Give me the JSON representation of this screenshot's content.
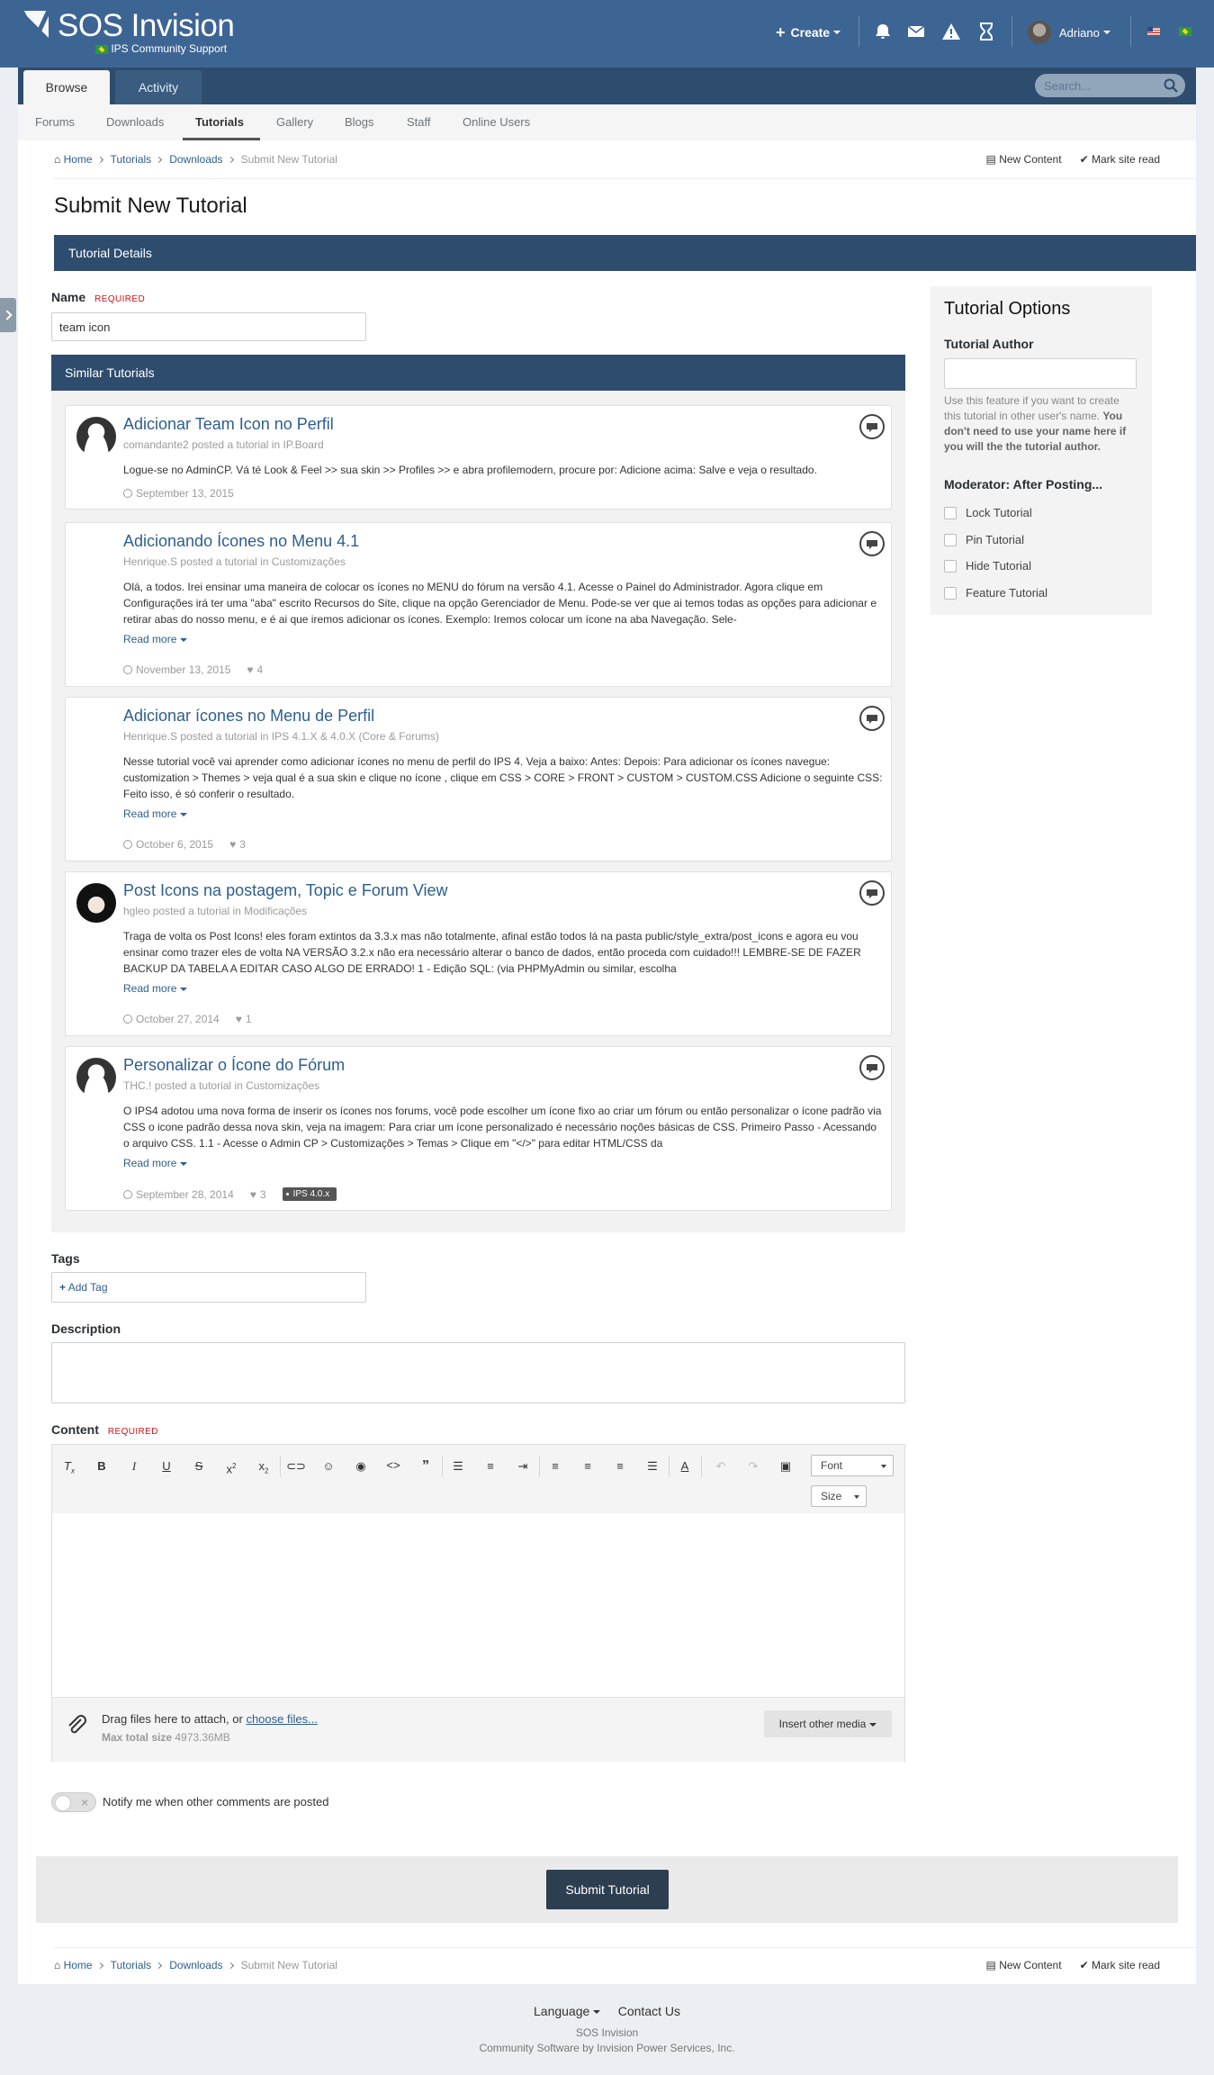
{
  "header": {
    "site_title": "SOS Invision",
    "site_subtitle": "IPS Community Support",
    "create_label": "Create",
    "username": "Adriano",
    "icons": [
      "bell-icon",
      "envelope-icon",
      "warning-icon",
      "hourglass-icon"
    ]
  },
  "nav": {
    "tabs": [
      {
        "label": "Browse",
        "active": true
      },
      {
        "label": "Activity",
        "active": false
      }
    ],
    "search_placeholder": "Search...",
    "sub_items": [
      {
        "label": "Forums"
      },
      {
        "label": "Downloads"
      },
      {
        "label": "Tutorials",
        "active": true
      },
      {
        "label": "Gallery"
      },
      {
        "label": "Blogs"
      },
      {
        "label": "Staff"
      },
      {
        "label": "Online Users"
      }
    ]
  },
  "breadcrumb": {
    "items": [
      "Home",
      "Tutorials",
      "Downloads"
    ],
    "current": "Submit New Tutorial",
    "new_content": "New Content",
    "mark_read": "Mark site read"
  },
  "page_title": "Submit New Tutorial",
  "section_header": "Tutorial Details",
  "form": {
    "name_label": "Name",
    "required_label": "REQUIRED",
    "name_value": "team icon",
    "similar_header": "Similar Tutorials",
    "tags_label": "Tags",
    "add_tag": "Add Tag",
    "description_label": "Description",
    "content_label": "Content",
    "font_label": "Font",
    "size_label": "Size",
    "drop_text": "Drag files here to attach, or",
    "choose_files": "choose files...",
    "max_size_label": "Max total size",
    "max_size_value": "4973.36MB",
    "insert_media": "Insert other media",
    "notify_label": "Notify me when other comments are posted",
    "submit_label": "Submit Tutorial"
  },
  "similar": [
    {
      "title": "Adicionar Team Icon no Perfil",
      "author": "comandante2",
      "posted": "posted a tutorial in",
      "category": "IP.Board",
      "snippet": "Logue-se no AdminCP. Vá té Look & Feel >> sua skin >> Profiles >> e abra profilemodern, procure por: Adicione acima: Salve e veja o resultado.",
      "date": "September 13, 2015",
      "likes": "",
      "read_more": "",
      "tag": "",
      "avatar": "default"
    },
    {
      "title": "Adicionando Ícones no Menu 4.1",
      "author": "Henrique.S",
      "posted": "posted a tutorial in",
      "category": "Customizações",
      "snippet": "Olá, a todos. Irei ensinar uma maneira de colocar os ícones no MENU do fórum na versão 4.1. Acesse o Painel do Administrador. Agora clique em Configurações irá ter uma \"aba\" escrito Recursos do Site, clique na opção Gerenciador de Menu. Pode-se ver que ai temos todas as opções para adicionar e retirar abas do nosso menu, e é ai que iremos adicionar os ícones. Exemplo: Iremos colocar um ícone na aba Navegação. Sele-",
      "date": "November 13, 2015",
      "likes": "4",
      "read_more": "Read more",
      "tag": "",
      "avatar": "none"
    },
    {
      "title": "Adicionar ícones no Menu de Perfil",
      "author": "Henrique.S",
      "posted": "posted a tutorial in",
      "category": "IPS 4.1.X & 4.0.X (Core & Forums)",
      "snippet": "Nesse tutorial você vai aprender como adicionar ícones no menu de perfil do IPS 4. Veja a baixo: Antes: Depois: Para adicionar os ícones navegue: customization > Themes > veja qual é a sua skin e clique no ícone , clique em CSS > CORE > FRONT > CUSTOM > CUSTOM.CSS Adicione o seguinte CSS: Feito isso, é só conferir o resultado.",
      "date": "October 6, 2015",
      "likes": "3",
      "read_more": "Read more",
      "tag": "",
      "avatar": "none"
    },
    {
      "title": "Post Icons na postagem, Topic e Forum View",
      "author": "hgleo",
      "posted": "posted a tutorial in",
      "category": "Modificações",
      "snippet": "Traga de volta os Post Icons! eles foram extintos da 3.3.x mas não totalmente, afinal estão todos lá na pasta public/style_extra/post_icons e agora eu vou ensinar como trazer eles de volta NA VERSÃO 3.2.x não era necessário alterar o banco de dados, então proceda com cuidado!!! LEMBRE-SE DE FAZER BACKUP DA TABELA A EDITAR CASO ALGO DE ERRADO! 1 - Edição SQL: (via PHPMyAdmin ou similar, escolha",
      "date": "October 27, 2014",
      "likes": "1",
      "read_more": "Read more",
      "tag": "",
      "avatar": "anime"
    },
    {
      "title": "Personalizar o Ícone do Fórum",
      "author": "THC.!",
      "posted": "posted a tutorial in",
      "category": "Customizações",
      "snippet": "O IPS4 adotou uma nova forma de inserir os ícones nos forums, você pode escolher um ícone fixo ao criar um fórum ou então personalizar o ícone padrão via CSS o icone padrão dessa nova skin, veja na imagem: Para criar um ícone personalizado é necessário noções básicas de CSS. Primeiro Passo - Acessando o arquivo CSS. 1.1 - Acesse o Admin CP > Customizações > Temas > Clique em \"</>\" para editar HTML/CSS da",
      "date": "September 28, 2014",
      "likes": "3",
      "read_more": "Read more",
      "tag": "IPS 4.0.x",
      "avatar": "default"
    }
  ],
  "sidebar": {
    "title": "Tutorial Options",
    "author_label": "Tutorial Author",
    "author_help": "Use this feature if you want to create this tutorial in other user's name.",
    "author_help_bold": "You don't need to use your name here if you will the the tutorial author.",
    "moderator_label": "Moderator: After Posting...",
    "options": [
      "Lock Tutorial",
      "Pin Tutorial",
      "Hide Tutorial",
      "Feature Tutorial"
    ]
  },
  "footer": {
    "language": "Language",
    "contact": "Contact Us",
    "site": "SOS Invision",
    "powered": "Community Software by Invision Power Services, Inc."
  }
}
